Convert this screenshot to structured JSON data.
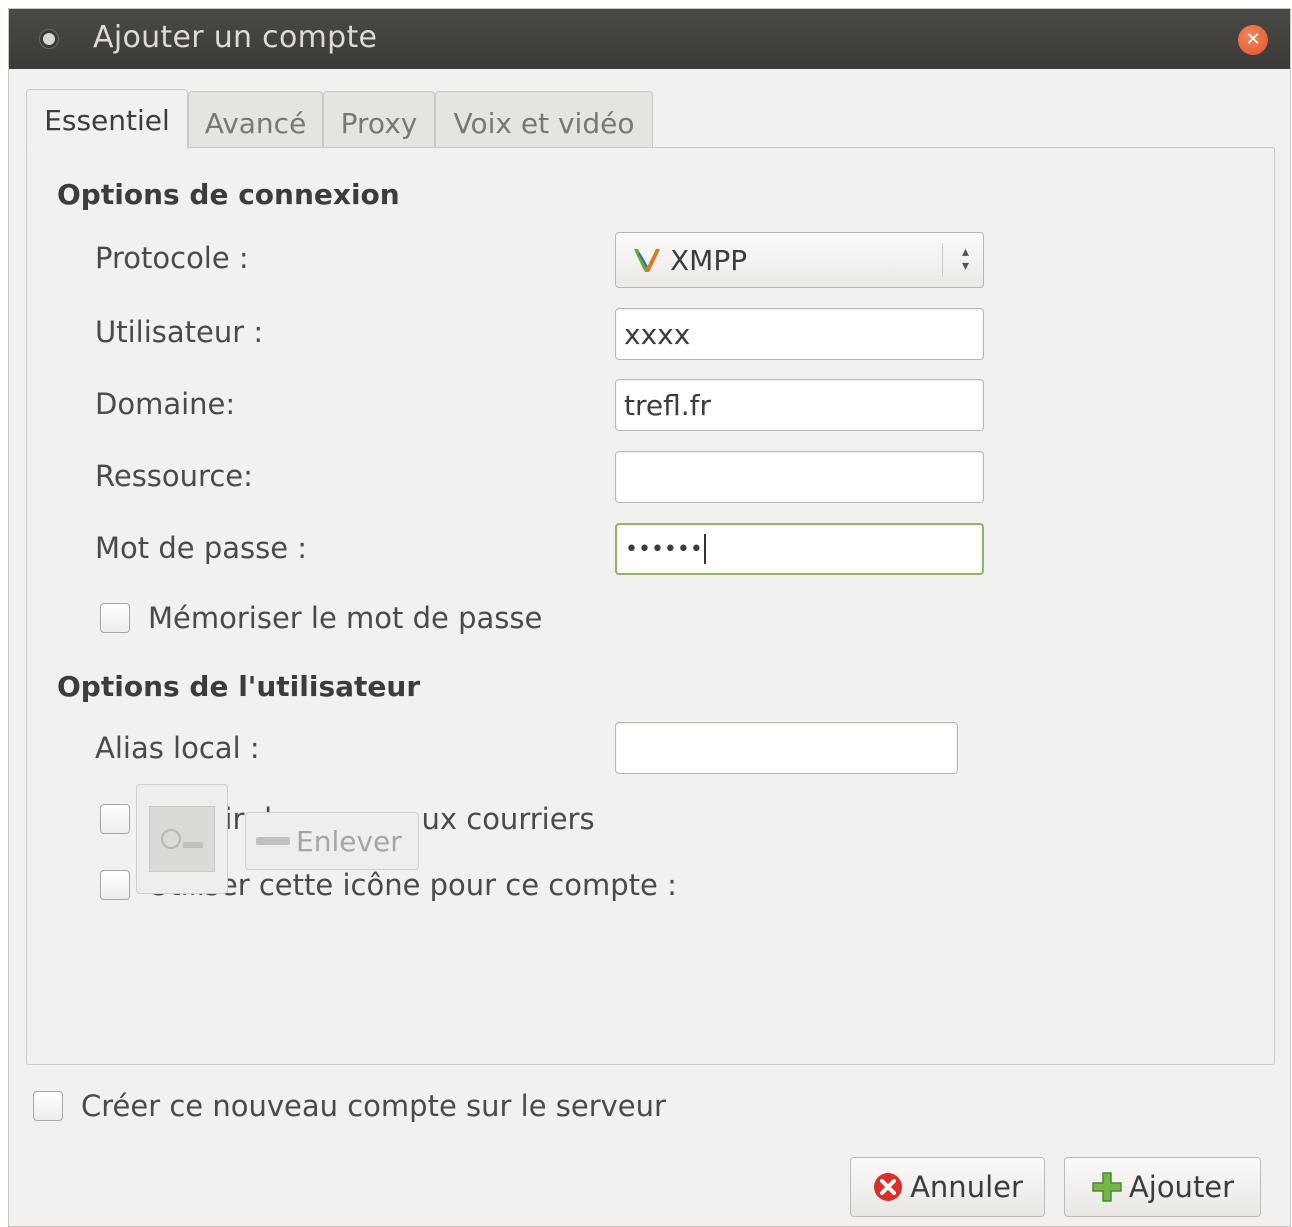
{
  "window": {
    "title": "Ajouter un compte",
    "close_icon": "close-icon"
  },
  "tabs": [
    {
      "label": "Essentiel",
      "active": true
    },
    {
      "label": "Avancé",
      "active": false
    },
    {
      "label": "Proxy",
      "active": false
    },
    {
      "label": "Voix et vidéo",
      "active": false
    }
  ],
  "login_options": {
    "title": "Options de connexion",
    "protocol_label": "Protocole :",
    "protocol_value": "XMPP",
    "protocol_icon": "xmpp-icon",
    "username_label": "Utilisateur :",
    "username_value": "xxxx",
    "domain_label": "Domaine:",
    "domain_value": "trefl.fr",
    "resource_label": "Ressource:",
    "resource_value": "",
    "password_label": "Mot de passe :",
    "password_value": "••••••",
    "remember_password_label": "Mémoriser le mot de passe",
    "remember_password_checked": false
  },
  "user_options": {
    "title": "Options de l'utilisateur",
    "alias_label": "Alias local :",
    "alias_value": "",
    "new_mail_label": "Avertir des nouveaux courriers",
    "new_mail_checked": false,
    "use_icon_label": "Utiliser cette icône pour ce compte :",
    "use_icon_checked": false,
    "remove_label": "Enlever"
  },
  "footer": {
    "create_account_label": "Créer ce nouveau compte sur le serveur",
    "create_account_checked": false,
    "cancel_label": "Annuler",
    "add_label": "Ajouter"
  },
  "colors": {
    "titlebar": "#3b3a36",
    "close": "#e0552b",
    "focus_border": "#8fb36b",
    "cancel_icon": "#d9302b",
    "add_icon": "#73b64a"
  }
}
